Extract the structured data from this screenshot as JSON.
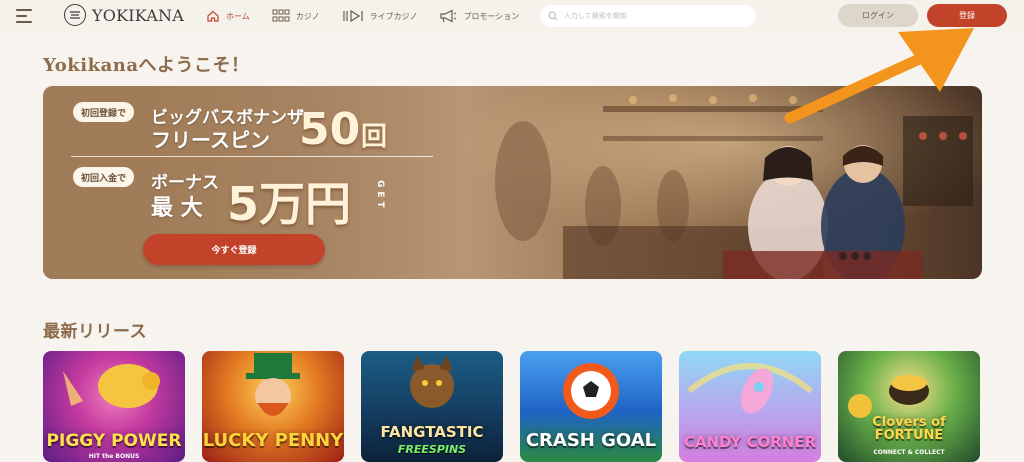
{
  "header": {
    "logo_text": "YOKIKANA",
    "nav": [
      {
        "label": "ホーム",
        "icon": "home-icon",
        "active": true
      },
      {
        "label": "カジノ",
        "icon": "grid-icon",
        "active": false
      },
      {
        "label": "ライブカジノ",
        "icon": "live-play-icon",
        "active": false
      },
      {
        "label": "プロモーション",
        "icon": "megaphone-icon",
        "active": false
      }
    ],
    "search_placeholder": "入力して検索を開始",
    "login_label": "ログイン",
    "register_label": "登録"
  },
  "welcome": "Yokikanaへようこそ！",
  "banner": {
    "pill1": "初回登録で",
    "line1": "ビッグバスボナンザ",
    "line2": "フリースピン",
    "num1": "50",
    "unit1": "回",
    "pill2": "初回入金で",
    "line3": "ボーナス",
    "line4": "最 大",
    "num2": "5万円",
    "get": "GET",
    "cta_label": "今すぐ登録"
  },
  "latest": {
    "title": "最新リリース",
    "games": [
      {
        "title": "PIGGY POWER",
        "sub": "HIT the BONUS",
        "bg1": "#e94ca9",
        "bg2": "#6a1e8f"
      },
      {
        "title": "LUCKY PENNY",
        "sub": "",
        "bg1": "#f2a12a",
        "bg2": "#b5261c"
      },
      {
        "title": "FANGTASTIC",
        "sub": "FREESPINS",
        "bg1": "#1b6a8f",
        "bg2": "#0f2a4a"
      },
      {
        "title": "CRASH GOAL",
        "sub": "",
        "bg1": "#3a8fe0",
        "bg2": "#0d3a7a"
      },
      {
        "title": "CANDY CORNER",
        "sub": "",
        "bg1": "#7fd0f0",
        "bg2": "#b070e0"
      },
      {
        "title": "Clovers of FORTUNE",
        "sub": "CONNECT & COLLECT",
        "bg1": "#6ab04a",
        "bg2": "#1f4a2a"
      }
    ]
  },
  "colors": {
    "accent": "#c2432a",
    "title_brown": "#8d6c4c",
    "arrow": "#f3951c"
  }
}
